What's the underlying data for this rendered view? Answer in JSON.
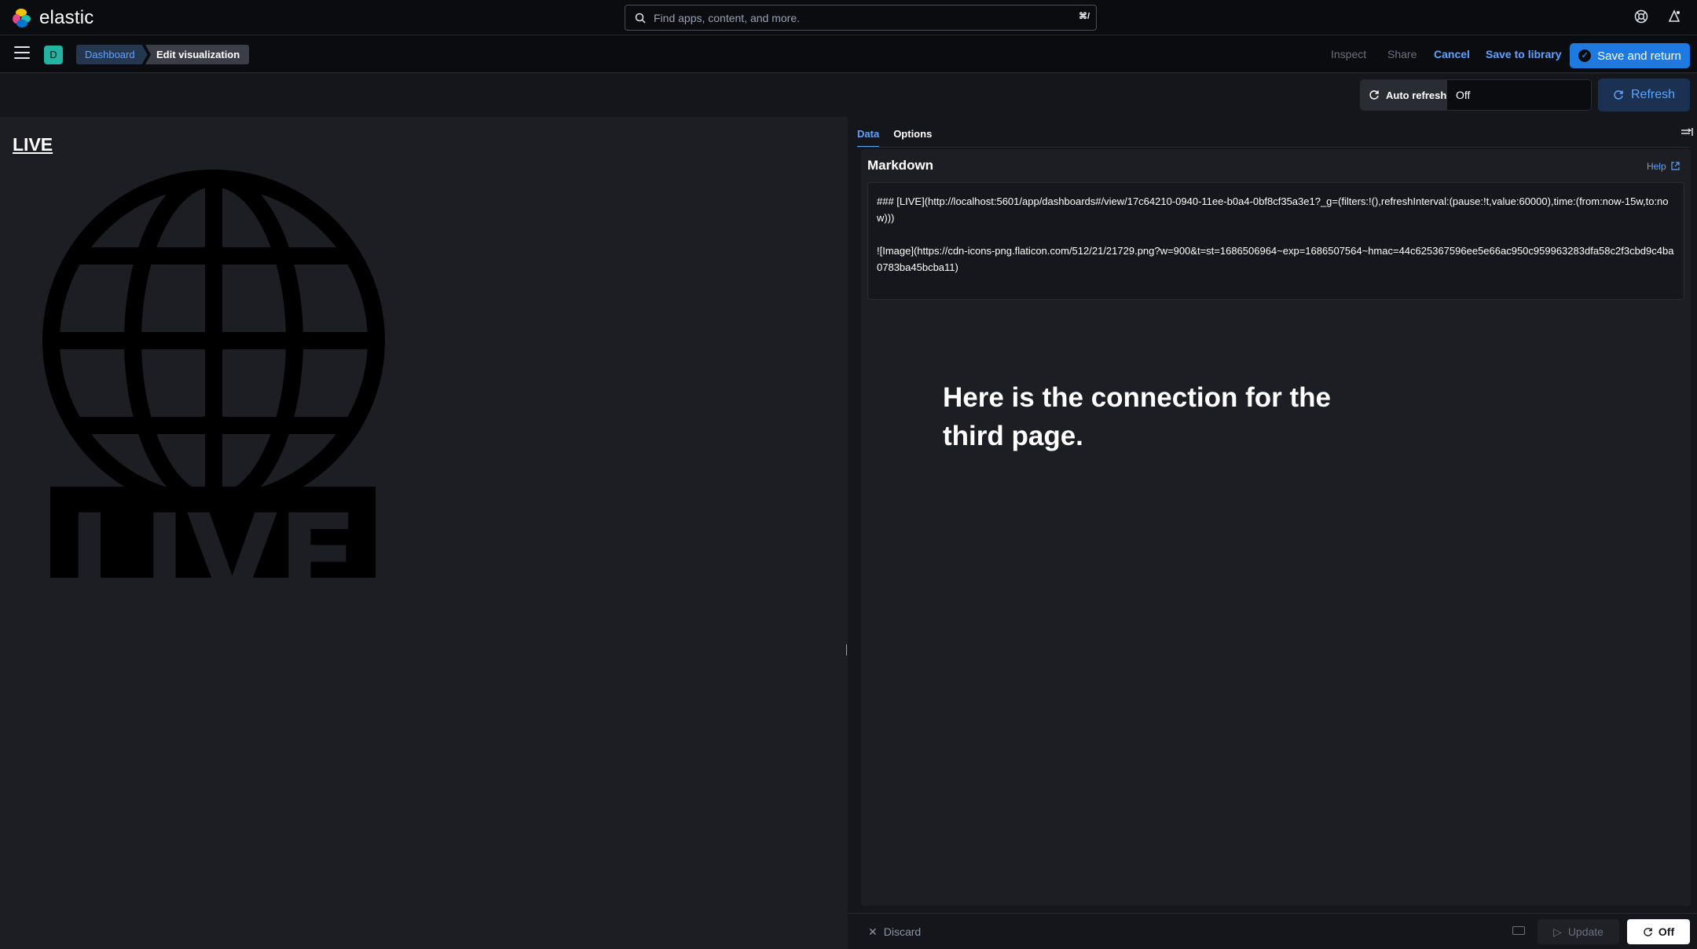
{
  "header": {
    "logo_text": "elastic",
    "search_placeholder": "Find apps, content, and more.",
    "search_shortcut": "⌘/",
    "help_icon": "help-icon",
    "news_icon": "newsfeed-icon"
  },
  "nav": {
    "space_initial": "D",
    "breadcrumbs": [
      "Dashboard",
      "Edit visualization"
    ],
    "inspect": "Inspect",
    "share": "Share",
    "cancel": "Cancel",
    "save_to_library": "Save to library",
    "save_and_return": "Save and return"
  },
  "toolbar": {
    "auto_refresh_label": "Auto refresh",
    "auto_refresh_value": "Off",
    "refresh": "Refresh"
  },
  "preview": {
    "link_text": "LIVE",
    "image_label": "LIVE"
  },
  "editor": {
    "tabs": [
      "Data",
      "Options"
    ],
    "active_tab": "Data",
    "panel_title": "Markdown",
    "help": "Help",
    "markdown_line1": "### [LIVE](http://localhost:5601/app/dashboards#/view/17c64210-0940-11ee-b0a4-0bf8cf35a3e1?_g=(filters:!(),refreshInterval:(pause:!t,value:60000),time:(from:now-15w,to:now)))",
    "markdown_line2": "![Image](https://cdn-icons-png.flaticon.com/512/21/21729.png?w=900&t=st=1686506964~exp=1686507564~hmac=44c625367596ee5e66ac950c959963283dfa58c2f3cbd9c4ba0783ba45bcba11)"
  },
  "overlay": {
    "text": "Here is the connection for the third page."
  },
  "bottombar": {
    "discard": "Discard",
    "update": "Update",
    "off": "Off"
  },
  "colors": {
    "accent": "#1e7ae0",
    "link": "#5ea3ff",
    "background": "#1d1e24"
  }
}
